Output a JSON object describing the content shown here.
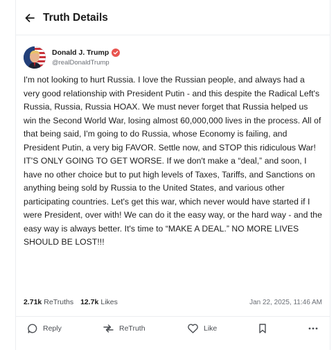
{
  "header": {
    "title": "Truth Details",
    "back_icon": "arrow-left-icon"
  },
  "author": {
    "name": "Donald J. Trump",
    "handle": "@realDonaldTrump",
    "verified_icon": "verified-badge-icon",
    "verified_color": "#e9544f"
  },
  "post": {
    "text": "I'm not looking to hurt Russia. I love the Russian people, and always had a very good relationship with President Putin - and this despite the Radical Left's Russia, Russia, Russia HOAX. We must never forget that Russia helped us win the Second World War, losing almost 60,000,000 lives in the process. All of that being said, I'm going to do Russia, whose Economy is failing, and President Putin, a very big FAVOR. Settle now, and STOP this ridiculous War! IT'S ONLY GOING TO GET WORSE. If we don't make a “deal,” and soon, I have no other choice but to put high levels of Taxes, Tariffs, and Sanctions on anything being sold by Russia to the United States, and various other participating countries. Let's get this war, which never would have started if I were President, over with! We can do it the easy way, or the hard way - and the easy way is always better. It's time to “MAKE A DEAL.” NO MORE LIVES SHOULD BE LOST!!!"
  },
  "stats": {
    "retruths_count": "2.71k",
    "retruths_label": "ReTruths",
    "likes_count": "12.7k",
    "likes_label": "Likes",
    "timestamp": "Jan 22, 2025, 11:46 AM"
  },
  "actions": {
    "reply": "Reply",
    "retruth": "ReTruth",
    "like": "Like"
  }
}
